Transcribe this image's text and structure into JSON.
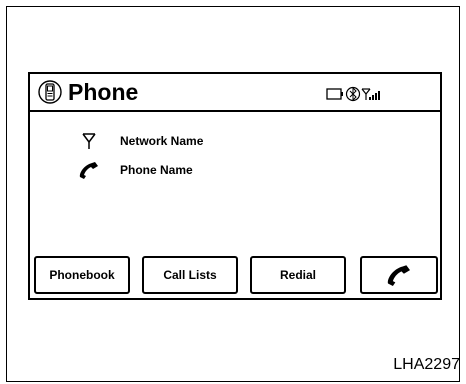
{
  "screen": {
    "title": "Phone",
    "title_icon": "phone-handset-icon",
    "status_icons": [
      "battery-icon",
      "bluetooth-icon",
      "signal-strength-icon"
    ]
  },
  "info": {
    "network_name": "Network Name",
    "phone_name": "Phone Name",
    "network_icon": "antenna-icon",
    "phone_icon": "phone-handset-icon"
  },
  "buttons": {
    "phonebook": "Phonebook",
    "call_lists": "Call Lists",
    "redial": "Redial",
    "call_icon": "phone-handset-icon"
  },
  "figure_code": "LHA2297"
}
